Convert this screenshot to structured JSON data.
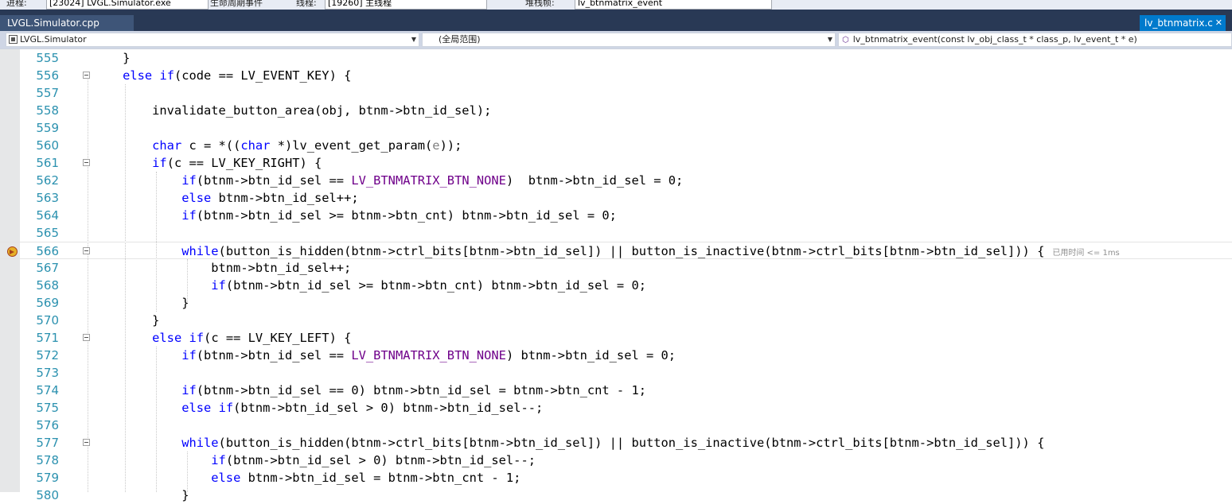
{
  "toolbar": {
    "process_label": "进程:",
    "process_value": "[23024] LVGL.Simulator.exe",
    "lifecycle_label": "生命周期事件",
    "thread_label": "线程:",
    "thread_value": "[19260] 主线程",
    "stackframe_label": "堆栈帧:",
    "stackframe_value": "lv_btnmatrix_event"
  },
  "tabs": {
    "active_file": "LVGL.Simulator.cpp",
    "right_file": "lv_btnmatrix.c",
    "right_close": "✕"
  },
  "navbar": {
    "project": "LVGL.Simulator",
    "scope": "(全局范围)",
    "function": "lv_btnmatrix_event(const lv_obj_class_t * class_p, lv_event_t * e)"
  },
  "editor": {
    "perf_tip": "已用时间 <= 1ms",
    "breakpoint_line": 566,
    "lines": [
      {
        "n": "555",
        "fold": false,
        "segs": [
          [
            "t",
            "    }"
          ]
        ]
      },
      {
        "n": "556",
        "fold": true,
        "segs": [
          [
            "t",
            "    "
          ],
          [
            "k",
            "else"
          ],
          [
            "t",
            " "
          ],
          [
            "k",
            "if"
          ],
          [
            "t",
            "(code == LV_EVENT_KEY) {"
          ]
        ]
      },
      {
        "n": "557",
        "fold": false,
        "segs": []
      },
      {
        "n": "558",
        "fold": false,
        "segs": [
          [
            "t",
            "        invalidate_button_area(obj, btnm->btn_id_sel);"
          ]
        ]
      },
      {
        "n": "559",
        "fold": false,
        "segs": []
      },
      {
        "n": "560",
        "fold": false,
        "segs": [
          [
            "t",
            "        "
          ],
          [
            "k",
            "char"
          ],
          [
            "t",
            " c = *(("
          ],
          [
            "k",
            "char"
          ],
          [
            "t",
            " *)lv_event_get_param("
          ],
          [
            "p",
            "e"
          ],
          [
            "t",
            "));"
          ]
        ]
      },
      {
        "n": "561",
        "fold": true,
        "segs": [
          [
            "t",
            "        "
          ],
          [
            "k",
            "if"
          ],
          [
            "t",
            "(c == LV_KEY_RIGHT) {"
          ]
        ]
      },
      {
        "n": "562",
        "fold": false,
        "segs": [
          [
            "t",
            "            "
          ],
          [
            "k",
            "if"
          ],
          [
            "t",
            "(btnm->btn_id_sel == "
          ],
          [
            "m",
            "LV_BTNMATRIX_BTN_NONE"
          ],
          [
            "t",
            ")  btnm->btn_id_sel = 0;"
          ]
        ]
      },
      {
        "n": "563",
        "fold": false,
        "segs": [
          [
            "t",
            "            "
          ],
          [
            "k",
            "else"
          ],
          [
            "t",
            " btnm->btn_id_sel++;"
          ]
        ]
      },
      {
        "n": "564",
        "fold": false,
        "segs": [
          [
            "t",
            "            "
          ],
          [
            "k",
            "if"
          ],
          [
            "t",
            "(btnm->btn_id_sel >= btnm->btn_cnt) btnm->btn_id_sel = 0;"
          ]
        ]
      },
      {
        "n": "565",
        "fold": false,
        "segs": []
      },
      {
        "n": "566",
        "fold": true,
        "segs": [
          [
            "t",
            "            "
          ],
          [
            "k",
            "while"
          ],
          [
            "t",
            "(button_is_hidden(btnm->ctrl_bits[btnm->btn_id_sel]) || button_is_inactive(btnm->ctrl_bits[btnm->btn_id_sel])) {"
          ]
        ]
      },
      {
        "n": "567",
        "fold": false,
        "segs": [
          [
            "t",
            "                btnm->btn_id_sel++;"
          ]
        ]
      },
      {
        "n": "568",
        "fold": false,
        "segs": [
          [
            "t",
            "                "
          ],
          [
            "k",
            "if"
          ],
          [
            "t",
            "(btnm->btn_id_sel >= btnm->btn_cnt) btnm->btn_id_sel = 0;"
          ]
        ]
      },
      {
        "n": "569",
        "fold": false,
        "segs": [
          [
            "t",
            "            }"
          ]
        ]
      },
      {
        "n": "570",
        "fold": false,
        "segs": [
          [
            "t",
            "        }"
          ]
        ]
      },
      {
        "n": "571",
        "fold": true,
        "segs": [
          [
            "t",
            "        "
          ],
          [
            "k",
            "else"
          ],
          [
            "t",
            " "
          ],
          [
            "k",
            "if"
          ],
          [
            "t",
            "(c == LV_KEY_LEFT) {"
          ]
        ]
      },
      {
        "n": "572",
        "fold": false,
        "segs": [
          [
            "t",
            "            "
          ],
          [
            "k",
            "if"
          ],
          [
            "t",
            "(btnm->btn_id_sel == "
          ],
          [
            "m",
            "LV_BTNMATRIX_BTN_NONE"
          ],
          [
            "t",
            ") btnm->btn_id_sel = 0;"
          ]
        ]
      },
      {
        "n": "573",
        "fold": false,
        "segs": []
      },
      {
        "n": "574",
        "fold": false,
        "segs": [
          [
            "t",
            "            "
          ],
          [
            "k",
            "if"
          ],
          [
            "t",
            "(btnm->btn_id_sel == 0) btnm->btn_id_sel = btnm->btn_cnt - 1;"
          ]
        ]
      },
      {
        "n": "575",
        "fold": false,
        "segs": [
          [
            "t",
            "            "
          ],
          [
            "k",
            "else"
          ],
          [
            "t",
            " "
          ],
          [
            "k",
            "if"
          ],
          [
            "t",
            "(btnm->btn_id_sel > 0) btnm->btn_id_sel--;"
          ]
        ]
      },
      {
        "n": "576",
        "fold": false,
        "segs": []
      },
      {
        "n": "577",
        "fold": true,
        "segs": [
          [
            "t",
            "            "
          ],
          [
            "k",
            "while"
          ],
          [
            "t",
            "(button_is_hidden(btnm->ctrl_bits[btnm->btn_id_sel]) || button_is_inactive(btnm->ctrl_bits[btnm->btn_id_sel])) {"
          ]
        ]
      },
      {
        "n": "578",
        "fold": false,
        "segs": [
          [
            "t",
            "                "
          ],
          [
            "k",
            "if"
          ],
          [
            "t",
            "(btnm->btn_id_sel > 0) btnm->btn_id_sel--;"
          ]
        ]
      },
      {
        "n": "579",
        "fold": false,
        "segs": [
          [
            "t",
            "                "
          ],
          [
            "k",
            "else"
          ],
          [
            "t",
            " btnm->btn_id_sel = btnm->btn_cnt - 1;"
          ]
        ]
      },
      {
        "n": "580",
        "fold": false,
        "segs": [
          [
            "t",
            "            }"
          ]
        ]
      }
    ]
  },
  "colors": {
    "keyword": "#0000ff",
    "macro": "#6f008a",
    "parameter": "#808080",
    "line_number": "#2b91af",
    "tab_active_blue": "#007acc"
  }
}
